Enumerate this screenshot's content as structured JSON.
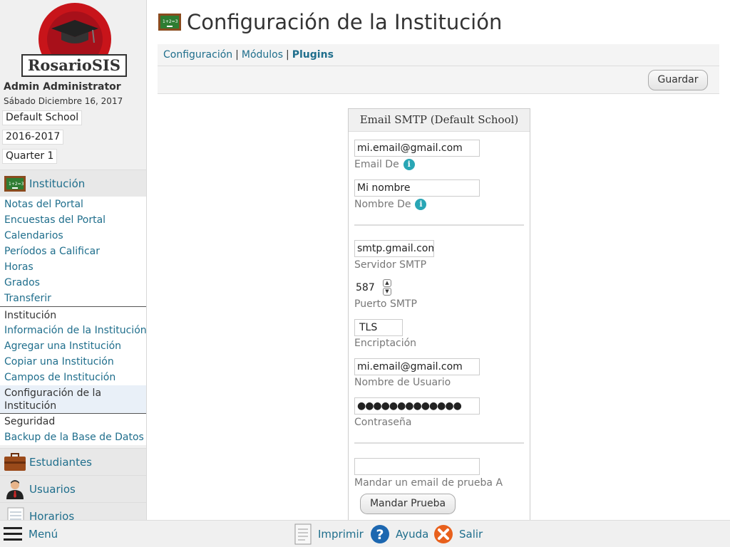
{
  "sidebar": {
    "logo_text": "RosarioSIS",
    "user_name": "Admin Administrator",
    "date": "Sábado Diciembre 16, 2017",
    "school": "Default School",
    "year": "2016-2017",
    "period": "Quarter 1",
    "module_institucion": "Institución",
    "items": [
      "Notas del Portal",
      "Encuestas del Portal",
      "Calendarios",
      "Períodos a Calificar",
      "Horas",
      "Grados",
      "Transferir",
      "Institución",
      "Información de la Institución",
      "Agregar una Institución",
      "Copiar una Institución",
      "Campos de Institución",
      "Configuración de la Institución",
      "Seguridad",
      "Backup de la Base de Datos"
    ],
    "module_estudiantes": "Estudiantes",
    "module_usuarios": "Usuarios",
    "module_horarios": "Horarios"
  },
  "header": {
    "title": "Configuración de la Institución",
    "tab_config": "Configuración",
    "tab_modulos": "Módulos",
    "tab_plugins": "Plugins",
    "separator": "|",
    "save_label": "Guardar"
  },
  "form": {
    "heading": "Email SMTP (Default School)",
    "email_from_value": "mi.email@gmail.com",
    "email_from_label": "Email De",
    "name_from_value": "Mi nombre",
    "name_from_label": "Nombre De",
    "smtp_server_value": "smtp.gmail.com",
    "smtp_server_label": "Servidor SMTP",
    "smtp_port_value": "587",
    "smtp_port_label": "Puerto SMTP",
    "encryption_value": "TLS",
    "encryption_label": "Encriptación",
    "username_value": "mi.email@gmail.com",
    "username_label": "Nombre de Usuario",
    "password_value": "●●●●●●●●●●●●●",
    "password_label": "Contraseña",
    "test_email_value": "",
    "test_email_label": "Mandar un email de prueba A",
    "test_button": "Mandar Prueba",
    "info_glyph": "i"
  },
  "bottom": {
    "menu": "Menú",
    "print": "Imprimir",
    "help": "Ayuda",
    "logout": "Salir"
  },
  "colors": {
    "link": "#1f6e8c",
    "logo_red": "#c8141a",
    "info": "#29a6b5",
    "logout_orange": "#e8601c",
    "help_blue": "#1c67b0"
  }
}
